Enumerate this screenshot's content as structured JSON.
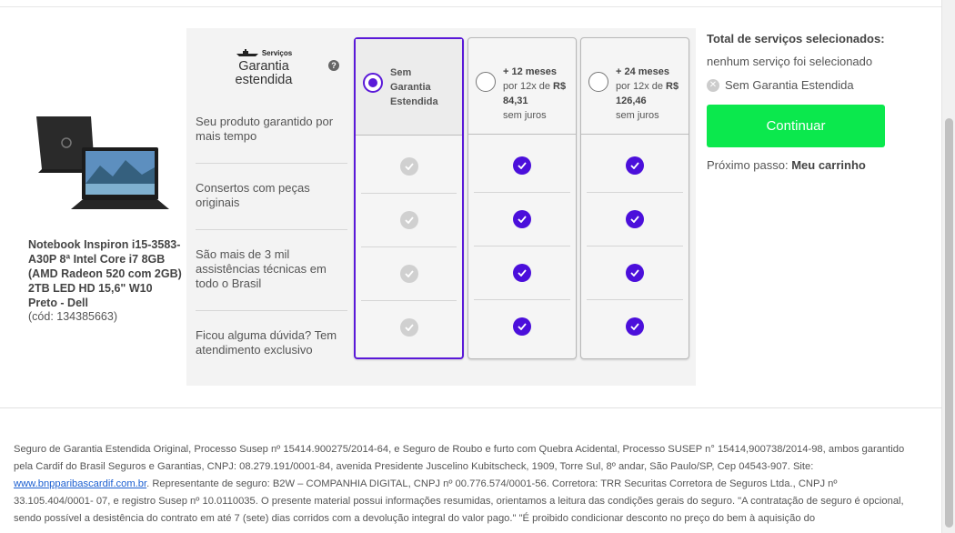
{
  "product": {
    "name": "Notebook Inspiron i15-3583-A30P 8ª Intel Core i7 8GB (AMD Radeon 520 com 2GB) 2TB LED HD 15,6\" W10 Preto - Dell",
    "code": "(cód: 134385663)",
    "image_icon": "laptop-image"
  },
  "logo": {
    "brand": "Serviços",
    "title_line1": "Garantia",
    "title_line2": "estendida"
  },
  "help_icon": "?",
  "features": [
    "Seu produto garantido por mais tempo",
    "Consertos com peças originais",
    "São mais de 3 mil assistências técnicas em todo o Brasil",
    "Ficou alguma dúvida? Tem atendimento exclusivo"
  ],
  "plans": [
    {
      "line1": "Sem",
      "line2": "Garantia",
      "line3": "Estendida",
      "selected": true,
      "included": [
        false,
        false,
        false,
        false
      ]
    },
    {
      "months": "+ 12 meses",
      "price_prefix": "por 12x de ",
      "currency": "R$",
      "price": "84,31",
      "interest": "sem juros",
      "selected": false,
      "included": [
        true,
        true,
        true,
        true
      ]
    },
    {
      "months": "+ 24 meses",
      "price_prefix": "por 12x de ",
      "currency": "R$",
      "price": "126,46",
      "interest": "sem juros",
      "selected": false,
      "included": [
        true,
        true,
        true,
        true
      ]
    }
  ],
  "summary": {
    "title": "Total de serviços selecionados:",
    "none_selected": "nenhum serviço foi selecionado",
    "item": "Sem Garantia Estendida",
    "continue_label": "Continuar",
    "next_prefix": "Próximo passo: ",
    "next_target": "Meu carrinho"
  },
  "legal": {
    "part1": "Seguro de Garantia Estendida Original, Processo Susep nº 15414.900275/2014-64, e Seguro de Roubo e furto com Quebra Acidental, Processo SUSEP n° 15414,900738/2014-98, ambos garantido pela Cardif do Brasil Seguros e Garantias, CNPJ: 08.279.191/0001-84, avenida Presidente Juscelino Kubitscheck, 1909, Torre Sul, 8º andar, São Paulo/SP, Cep 04543-907. Site: ",
    "link": "www.bnpparibascardif.com.br",
    "part2": ". Representante de seguro: B2W – COMPANHIA DIGITAL, CNPJ nº 00.776.574/0001-56. Corretora: TRR Securitas Corretora de Seguros Ltda., CNPJ nº 33.105.404/0001- 07, e registro Susep nº 10.0110035. O presente material possui informações resumidas, orientamos a leitura das condições gerais do seguro. \"A contratação de seguro é opcional, sendo possível a desistência do contrato em até 7 (sete) dias corridos com a devolução integral do valor pago.\" \"É proibido condicionar desconto no preço do bem à aquisição do"
  }
}
